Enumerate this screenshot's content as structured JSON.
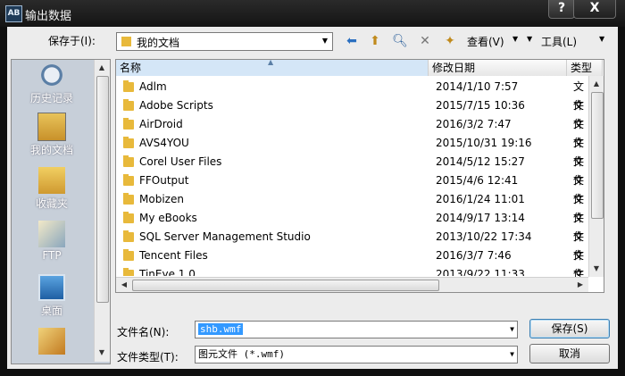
{
  "window": {
    "title": "输出数据",
    "app_icon": "AB",
    "help_label": "?",
    "close_label": "X"
  },
  "toolbar": {
    "save_in_label": "保存于(I):",
    "save_in_value": "我的文档",
    "view_label": "查看(V)",
    "tools_label": "工具(L)"
  },
  "places": [
    {
      "label": "历史记录",
      "icon": "history-icon"
    },
    {
      "label": "我的文档",
      "icon": "my-documents-icon"
    },
    {
      "label": "收藏夹",
      "icon": "favorites-icon"
    },
    {
      "label": "FTP",
      "icon": "ftp-icon"
    },
    {
      "label": "桌面",
      "icon": "desktop-icon"
    }
  ],
  "columns": {
    "name": "名称",
    "modified": "修改日期",
    "type": "类型"
  },
  "files": [
    {
      "name": "Adlm",
      "date": "2014/1/10 7:57",
      "type": "文件"
    },
    {
      "name": "Adobe Scripts",
      "date": "2015/7/15 10:36",
      "type": "文件"
    },
    {
      "name": "AirDroid",
      "date": "2016/3/2 7:47",
      "type": "文件"
    },
    {
      "name": "AVS4YOU",
      "date": "2015/10/31 19:16",
      "type": "文件"
    },
    {
      "name": "Corel User Files",
      "date": "2014/5/12 15:27",
      "type": "文件"
    },
    {
      "name": "FFOutput",
      "date": "2015/4/6 12:41",
      "type": "文件"
    },
    {
      "name": "Mobizen",
      "date": "2016/1/24 11:01",
      "type": "文件"
    },
    {
      "name": "My eBooks",
      "date": "2014/9/17 13:14",
      "type": "文件"
    },
    {
      "name": "SQL Server Management Studio",
      "date": "2013/10/22 17:34",
      "type": "文件"
    },
    {
      "name": "Tencent Files",
      "date": "2016/3/7 7:46",
      "type": "文件"
    },
    {
      "name": "TinEye 1.0",
      "date": "2013/9/22 11:33",
      "type": "文件"
    }
  ],
  "filename": {
    "label": "文件名(N):",
    "value": "shb.wmf"
  },
  "filetype": {
    "label": "文件类型(T):",
    "value": "图元文件 (*.wmf)"
  },
  "buttons": {
    "save": "保存(S)",
    "cancel": "取消"
  }
}
